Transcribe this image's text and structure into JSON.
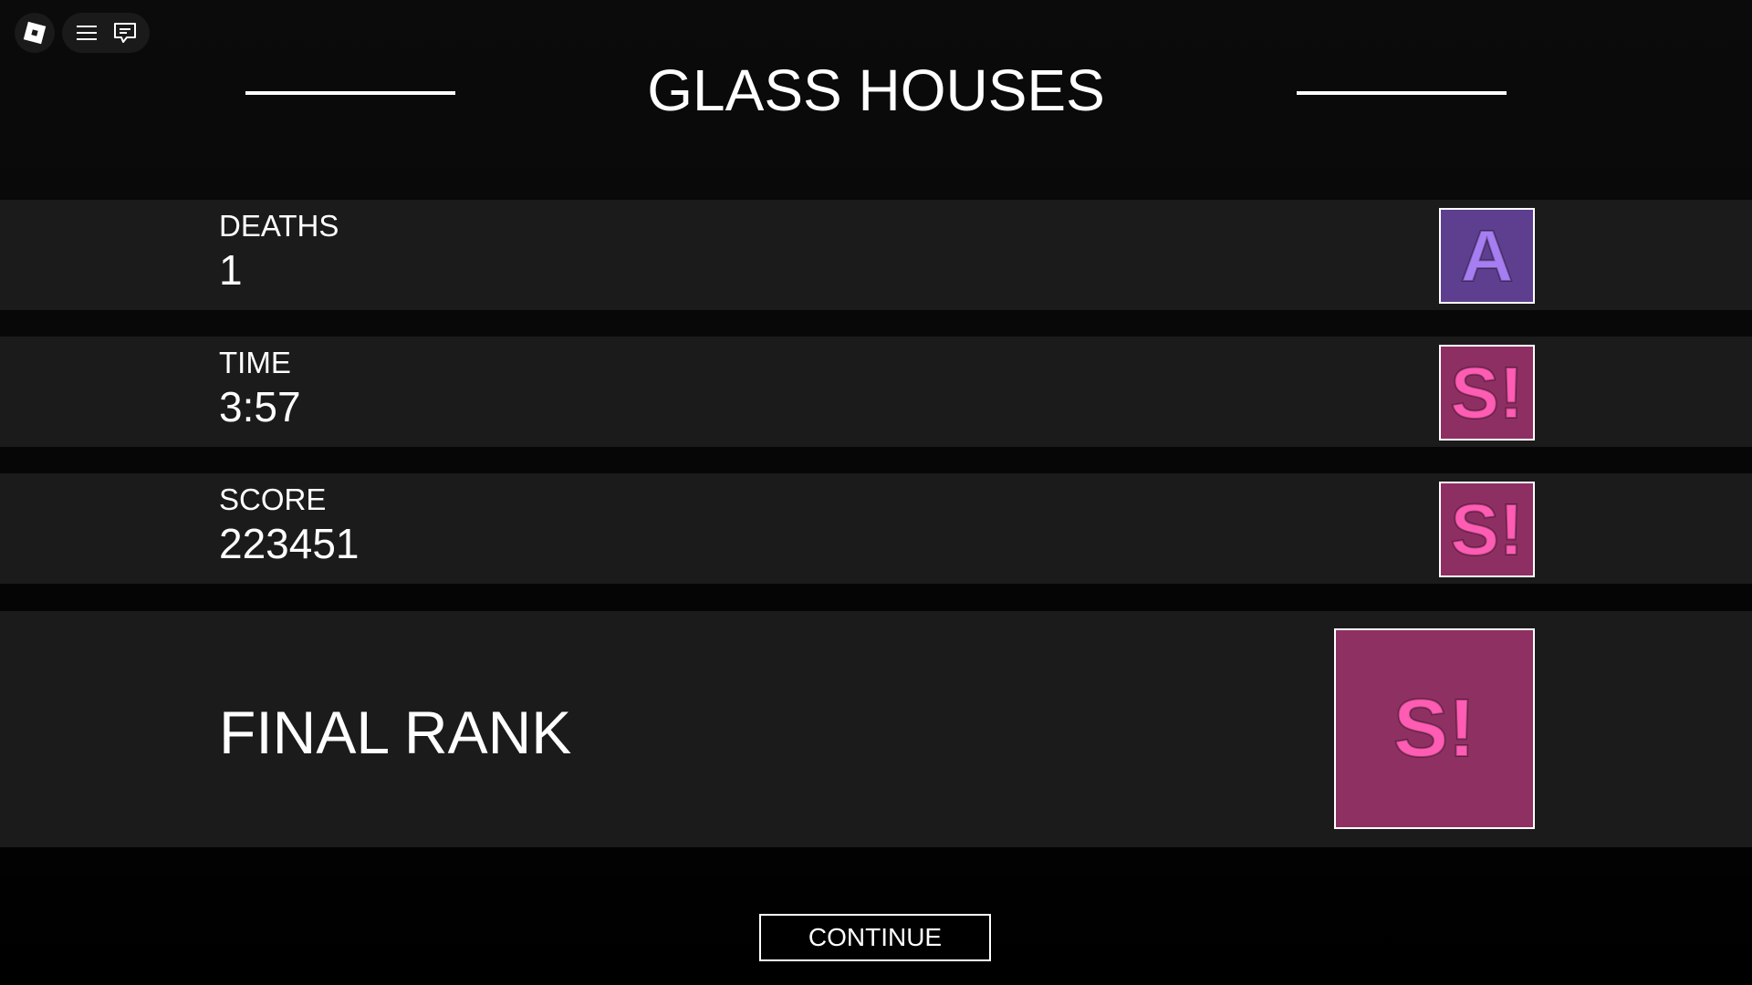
{
  "title": "GLASS HOUSES",
  "stats": [
    {
      "label": "DEATHS",
      "value": "1",
      "rank": "A",
      "rank_bg": "#5e3f8f",
      "rank_fg": "#a77df2"
    },
    {
      "label": "TIME",
      "value": "3:57",
      "rank": "S!",
      "rank_bg": "#8e2f63",
      "rank_fg": "#ff5cb3"
    },
    {
      "label": "SCORE",
      "value": "223451",
      "rank": "S!",
      "rank_bg": "#8e2f63",
      "rank_fg": "#ff5cb3"
    }
  ],
  "final": {
    "label": "FINAL RANK",
    "rank": "S!",
    "rank_bg": "#8e3162",
    "rank_fg": "#ff5cb3"
  },
  "continue_label": "CONTINUE",
  "icons": {
    "roblox": "roblox-logo-icon",
    "menu": "hamburger-menu-icon",
    "chat": "chat-icon"
  }
}
